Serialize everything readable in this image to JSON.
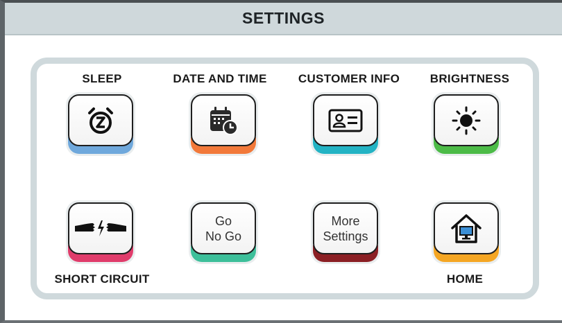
{
  "header": {
    "title": "SETTINGS"
  },
  "tiles": [
    {
      "label": "SLEEP",
      "icon": "alarm-clock-icon",
      "color": "#6fa8dc"
    },
    {
      "label": "DATE AND TIME",
      "icon": "calendar-clock-icon",
      "color": "#f2793a"
    },
    {
      "label": "CUSTOMER INFO",
      "icon": "id-card-icon",
      "color": "#23b3c4"
    },
    {
      "label": "BRIGHTNESS",
      "icon": "sun-icon",
      "color": "#4cbb47"
    },
    {
      "label": "SHORT CIRCUIT",
      "icon": "broken-cable-icon",
      "color": "#e03c6b"
    },
    {
      "label": "",
      "text": "Go\nNo Go",
      "color": "#3dbf9a"
    },
    {
      "label": "",
      "text": "More\nSettings",
      "color": "#8b1f24"
    },
    {
      "label": "HOME",
      "icon": "home-monitor-icon",
      "color": "#f5a623"
    }
  ],
  "colors": {
    "title_bar": "#cfd8db",
    "panel_border": "#cfd9dc",
    "tile_border": "#1e1e1e"
  }
}
